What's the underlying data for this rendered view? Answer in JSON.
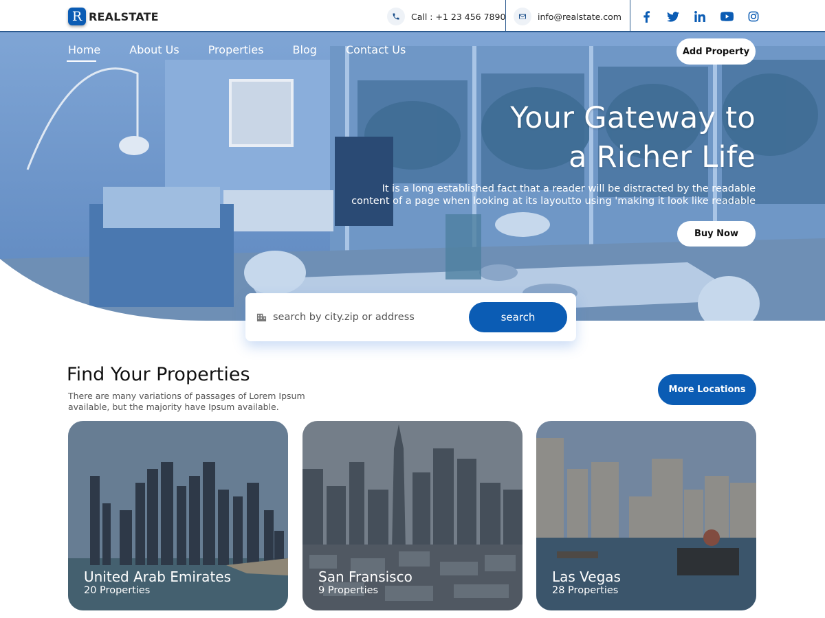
{
  "brand": {
    "logo_letter": "R",
    "name": "REALSTATE",
    "accent": "#0b5cb4"
  },
  "topbar": {
    "phone": "Call : +1 23 456 7890",
    "email": "info@realstate.com",
    "socials": [
      "facebook-icon",
      "twitter-icon",
      "linkedin-icon",
      "youtube-icon",
      "instagram-icon"
    ]
  },
  "nav": {
    "items": [
      "Home",
      "About Us",
      "Properties",
      "Blog",
      "Contact Us"
    ],
    "active": "Home",
    "add_property": "Add Property"
  },
  "hero": {
    "title_line1": "Your Gateway to",
    "title_line2": "a Richer Life",
    "description_line1": "It is a long established fact that a reader will be distracted by the readable",
    "description_line2": "content of a page when looking at its layoutto using 'making it look like readable",
    "buy_now": "Buy Now"
  },
  "search": {
    "placeholder": "search by city.zip or address",
    "button": "search"
  },
  "section": {
    "title": "Find Your Properties",
    "subtitle": "There are many variations of passages of Lorem Ipsum available, but the majority have Ipsum available.",
    "more_button": "More Locations"
  },
  "locations": [
    {
      "name": "United Arab Emirates",
      "count": "20 Properties"
    },
    {
      "name": "San Fransisco",
      "count": "9 Properties"
    },
    {
      "name": "Las Vegas",
      "count": "28 Properties"
    }
  ]
}
